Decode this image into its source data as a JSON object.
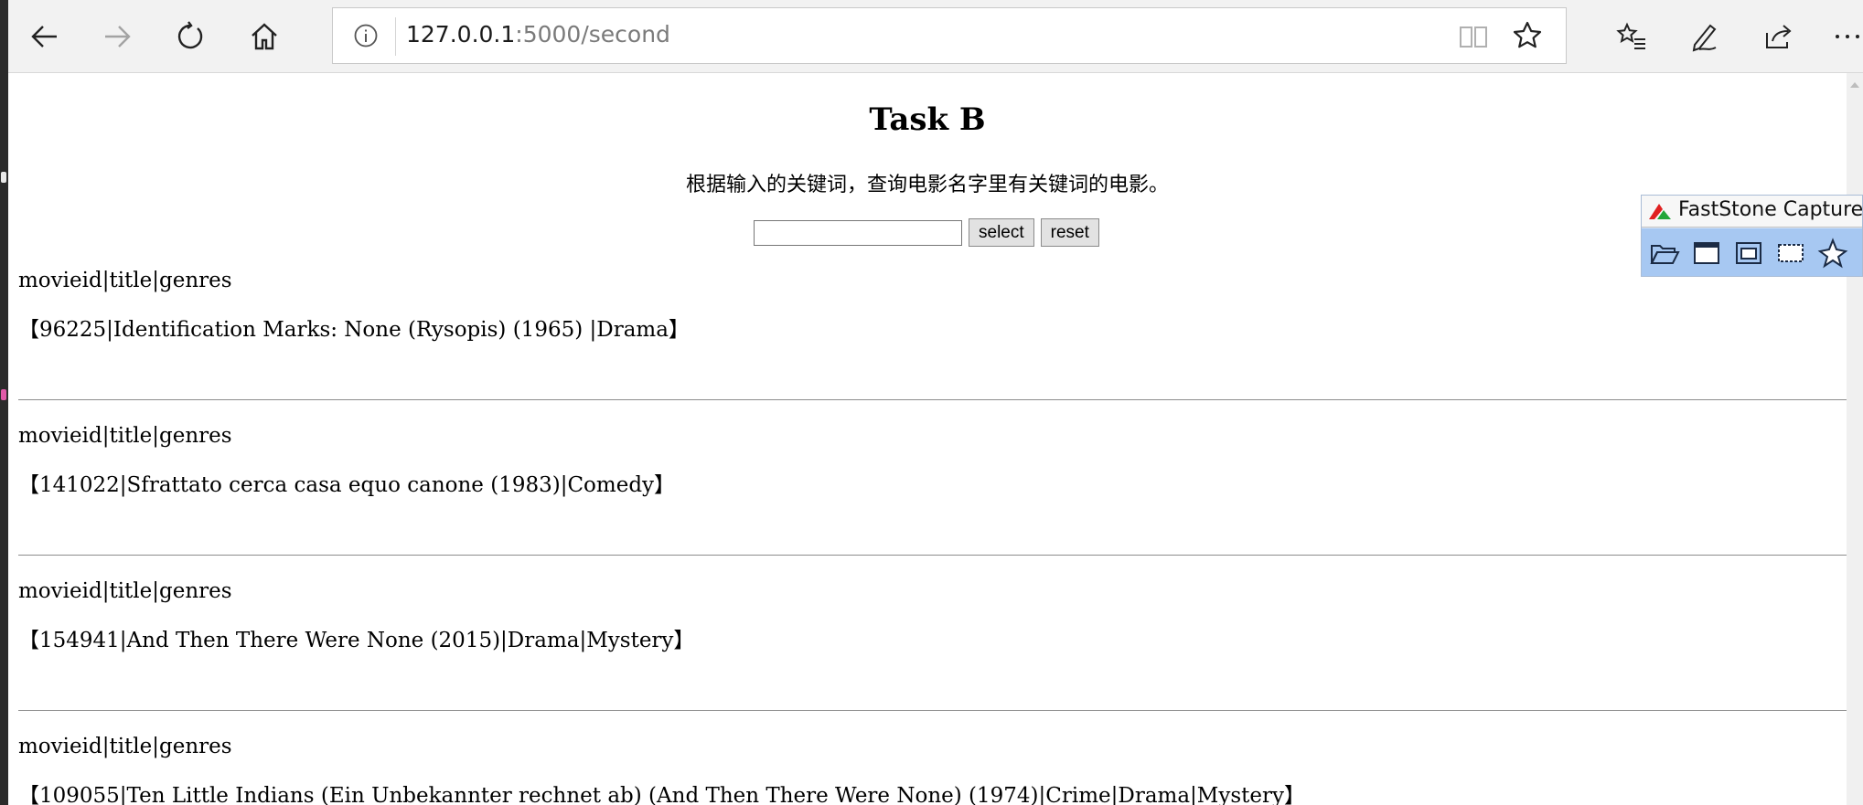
{
  "browser": {
    "url_host": "127.0.0.1",
    "url_path": ":5000/second",
    "nav_icons": [
      "back-arrow-icon",
      "forward-arrow-icon",
      "refresh-icon",
      "home-icon"
    ],
    "action_icons": [
      "favorites-list-icon",
      "pen-icon",
      "share-icon",
      "more-icon"
    ]
  },
  "page": {
    "title": "Task B",
    "description": "根据输入的关键词，查询电影名字里有关键词的电影。",
    "search": {
      "value": "",
      "select_label": "select",
      "reset_label": "reset"
    },
    "records": [
      {
        "header": "movieid|title|genres",
        "line": "【96225|Identification Marks: None (Rysopis) (1965) |Drama】"
      },
      {
        "header": "movieid|title|genres",
        "line": "【141022|Sfrattato cerca casa equo canone (1983)|Comedy】"
      },
      {
        "header": "movieid|title|genres",
        "line": "【154941|And Then There Were None (2015)|Drama|Mystery】"
      },
      {
        "header": "movieid|title|genres",
        "line": "【109055|Ten Little Indians (Ein Unbekannter rechnet ab) (And Then There Were None) (1974)|Crime|Drama|Mystery】"
      }
    ]
  },
  "faststone": {
    "title": "FastStone Capture",
    "tools": [
      "open-folder-icon",
      "capture-window-icon",
      "capture-object-icon",
      "capture-rectangle-icon",
      "capture-freehand-icon"
    ]
  }
}
